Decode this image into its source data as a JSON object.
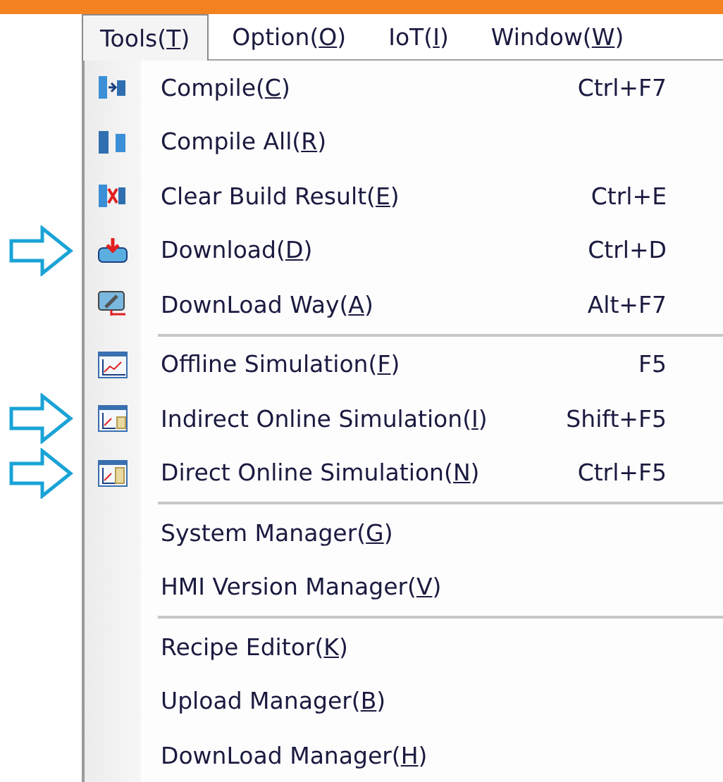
{
  "menubar": [
    {
      "before": "Tools(",
      "key": "T",
      "after": ")",
      "selected": true
    },
    {
      "before": "Option(",
      "key": "O",
      "after": ")",
      "selected": false
    },
    {
      "before": "IoT(",
      "key": "I",
      "after": ")",
      "selected": false
    },
    {
      "before": "Window(",
      "key": "W",
      "after": ")",
      "selected": false
    }
  ],
  "menu": [
    {
      "kind": "item",
      "before": "Compile(",
      "key": "C",
      "after": ")",
      "shortcut": "Ctrl+F7",
      "pointed": false
    },
    {
      "kind": "item",
      "before": "Compile All(",
      "key": "R",
      "after": ")",
      "pointed": false
    },
    {
      "kind": "item",
      "before": "Clear Build Result(",
      "key": "E",
      "after": ")",
      "shortcut": "Ctrl+E",
      "pointed": false
    },
    {
      "kind": "item",
      "before": "Download(",
      "key": "D",
      "after": ")",
      "shortcut": "Ctrl+D",
      "pointed": true
    },
    {
      "kind": "item",
      "before": "DownLoad Way(",
      "key": "A",
      "after": ")",
      "shortcut": "Alt+F7",
      "pointed": false
    },
    {
      "kind": "separator"
    },
    {
      "kind": "item",
      "before": "Offline Simulation(",
      "key": "F",
      "after": ")",
      "shortcut": "F5",
      "pointed": false
    },
    {
      "kind": "item",
      "before": "Indirect Online Simulation(",
      "key": "I",
      "after": ")",
      "shortcut": "Shift+F5",
      "pointed": true
    },
    {
      "kind": "item",
      "before": "Direct Online Simulation(",
      "key": "N",
      "after": ")",
      "shortcut": "Ctrl+F5",
      "pointed": true
    },
    {
      "kind": "separator"
    },
    {
      "kind": "item",
      "before": "System Manager(",
      "key": "G",
      "after": ")",
      "pointed": false
    },
    {
      "kind": "item",
      "before": "HMI Version Manager(",
      "key": "V",
      "after": ")",
      "pointed": false
    },
    {
      "kind": "separator"
    },
    {
      "kind": "item",
      "before": "Recipe Editor(",
      "key": "K",
      "after": ")",
      "pointed": false
    },
    {
      "kind": "item",
      "before": "Upload Manager(",
      "key": "B",
      "after": ")",
      "pointed": false
    },
    {
      "kind": "item",
      "before": "DownLoad Manager(",
      "key": "H",
      "after": ")",
      "pointed": false
    }
  ]
}
